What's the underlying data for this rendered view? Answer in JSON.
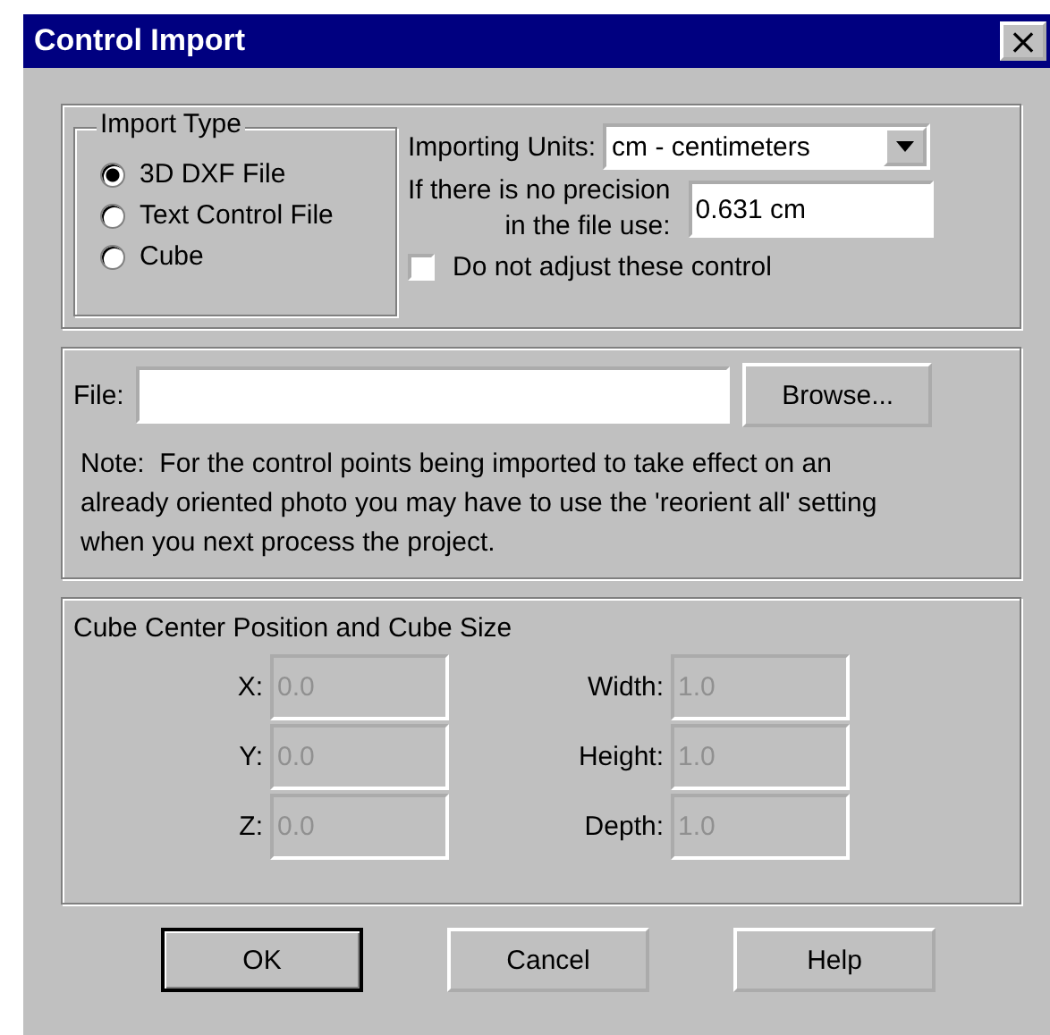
{
  "window": {
    "title": "Control Import",
    "close": "×"
  },
  "import_type": {
    "legend": "Import Type",
    "options": [
      {
        "label": "3D DXF File",
        "selected": true
      },
      {
        "label": "Text Control File",
        "selected": false
      },
      {
        "label": "Cube",
        "selected": false
      }
    ]
  },
  "units": {
    "label": "Importing Units:",
    "value": "cm - centimeters"
  },
  "precision": {
    "label_lines": [
      "If there is no precision",
      "in the file use:"
    ],
    "value": "0.631 cm"
  },
  "adjust": {
    "label": "Do not adjust these control",
    "checked": false
  },
  "file": {
    "label": "File:",
    "button": "Browse...",
    "note": "Note:  For the control points being imported to take effect on an already oriented photo you may have to use the 'reorient all' setting when you next process the project."
  },
  "cube": {
    "title": "Cube Center Position and Cube Size",
    "fields": [
      {
        "label": "X:",
        "value": "0.0",
        "disabled": true
      },
      {
        "label": "Width:",
        "value": "1.0",
        "disabled": true
      },
      {
        "label": "Y:",
        "value": "0.0",
        "disabled": true
      },
      {
        "label": "Height:",
        "value": "1.0",
        "disabled": true
      },
      {
        "label": "Z:",
        "value": "0.0",
        "disabled": true
      },
      {
        "label": "Depth:",
        "value": "1.0",
        "disabled": true
      }
    ]
  },
  "buttons": [
    {
      "label": "OK",
      "default": true
    },
    {
      "label": "Cancel",
      "default": false
    },
    {
      "label": "Help",
      "default": false
    }
  ]
}
